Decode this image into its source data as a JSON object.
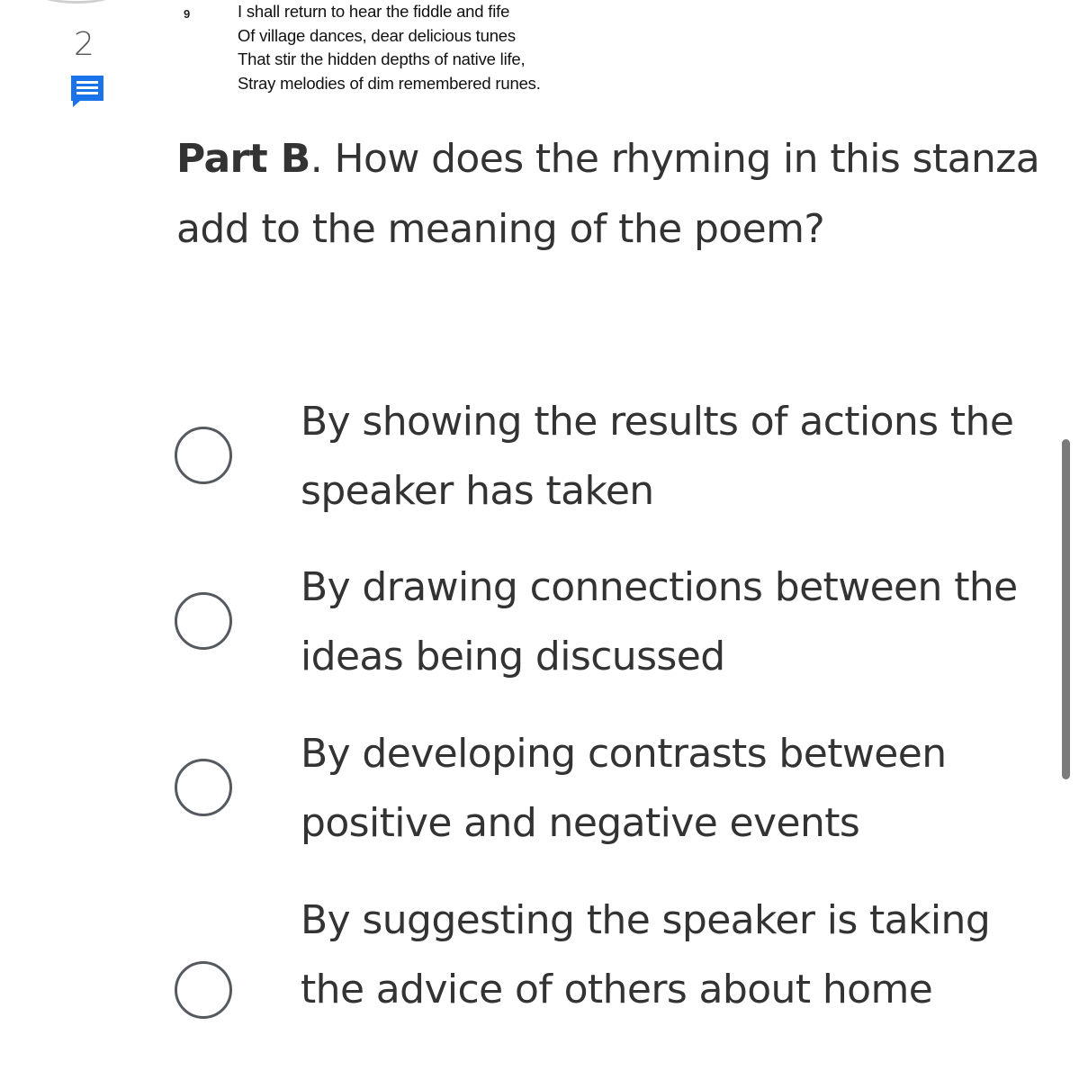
{
  "question_number": "2",
  "poem": {
    "line_number": "9",
    "lines": [
      "I shall return to hear the fiddle and fife",
      "Of village dances, dear delicious tunes",
      "That stir the hidden depths of native life,",
      "Stray melodies of dim remembered runes."
    ]
  },
  "question": {
    "part_label": "Part B",
    "text": ". How does the rhyming in this stanza add to the meaning of the poem?"
  },
  "options": [
    {
      "text": "By showing the results of actions the speaker has taken",
      "selected": false
    },
    {
      "text": "By drawing connections between the ideas being discussed",
      "selected": false
    },
    {
      "text": "By developing contrasts between positive and negative events",
      "selected": false
    },
    {
      "text": "By suggesting the speaker is taking the advice of others about home",
      "selected": false
    }
  ],
  "colors": {
    "note_icon": "#1a73e8",
    "text": "#333333",
    "radio_border": "#555a60",
    "scrollbar": "#7b7b7b"
  },
  "icons": {
    "note": "note-icon",
    "radio": "radio-icon"
  }
}
